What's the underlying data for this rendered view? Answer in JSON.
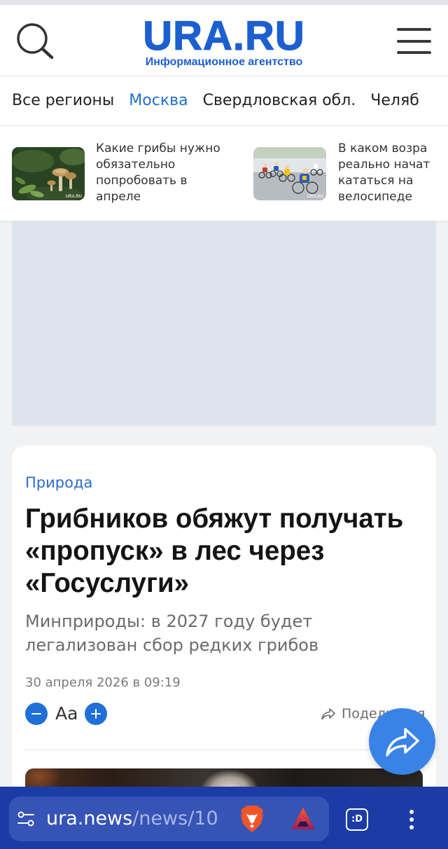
{
  "header": {
    "logo": "URA.RU",
    "logo_subtitle": "Информационное агентство"
  },
  "regions": {
    "items": [
      {
        "label": "Все регионы",
        "active": false
      },
      {
        "label": "Москва",
        "active": true
      },
      {
        "label": "Свердловская обл.",
        "active": false
      },
      {
        "label": "Челяб",
        "active": false
      }
    ]
  },
  "featured": [
    {
      "image": "mushrooms-photo",
      "watermark": "URA.RU",
      "title_lines": [
        "Какие грибы нужно",
        "обязательно",
        "попробовать в",
        "апреле"
      ]
    },
    {
      "image": "cyclists-photo",
      "watermark": "URA.RU",
      "title_lines": [
        "В каком возра",
        "реально начат",
        "кататься на",
        "велосипеде"
      ]
    }
  ],
  "article": {
    "rubric": "Природа",
    "headline": "Грибников обяжут получать «пропуск» в лес через «Госуслуги»",
    "subtitle": "Минприроды: в 2027 году будет легализован сбор редких грибов",
    "date": "30 апреля 2026 в 09:19",
    "font_size_label": "Aa",
    "share_label": "Поделиться"
  },
  "browser": {
    "url_host": "ura.news",
    "url_path": "/news/10",
    "tabs_label": ":D"
  },
  "icons": {
    "search": "search-icon",
    "menu": "hamburger-menu-icon",
    "font_smaller": "minus-circle-icon",
    "font_larger": "plus-circle-icon",
    "share": "share-arrow-icon",
    "fab": "share-arrow-icon",
    "site_settings": "tune-icon",
    "brave_shields": "brave-lion-icon",
    "rewards": "bat-triangle-icon",
    "tabs": "tabs-icon",
    "browser_menu": "vertical-dots-icon"
  },
  "colors": {
    "brand_blue": "#1c5fcf",
    "active_region": "#1f6fd1",
    "rubric": "#2b6ccc",
    "font_controls": "#1f6fd8",
    "fab": "#3a83e6",
    "browser_bar": "#1c3ca5",
    "url_pill": "#3654b6",
    "ad_placeholder": "#dee4ed",
    "page_bg": "#f1f2f4"
  }
}
